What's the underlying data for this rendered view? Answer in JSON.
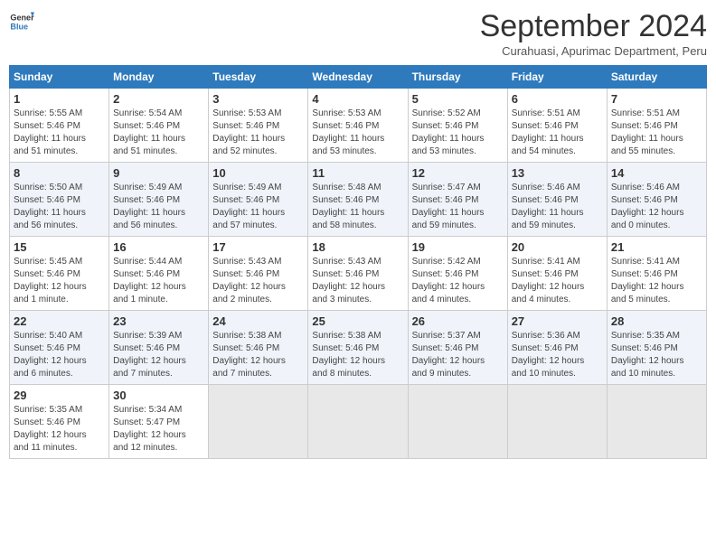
{
  "header": {
    "logo_line1": "General",
    "logo_line2": "Blue",
    "month_title": "September 2024",
    "subtitle": "Curahuasi, Apurimac Department, Peru"
  },
  "weekdays": [
    "Sunday",
    "Monday",
    "Tuesday",
    "Wednesday",
    "Thursday",
    "Friday",
    "Saturday"
  ],
  "weeks": [
    [
      {
        "day": "1",
        "info": "Sunrise: 5:55 AM\nSunset: 5:46 PM\nDaylight: 11 hours\nand 51 minutes."
      },
      {
        "day": "2",
        "info": "Sunrise: 5:54 AM\nSunset: 5:46 PM\nDaylight: 11 hours\nand 51 minutes."
      },
      {
        "day": "3",
        "info": "Sunrise: 5:53 AM\nSunset: 5:46 PM\nDaylight: 11 hours\nand 52 minutes."
      },
      {
        "day": "4",
        "info": "Sunrise: 5:53 AM\nSunset: 5:46 PM\nDaylight: 11 hours\nand 53 minutes."
      },
      {
        "day": "5",
        "info": "Sunrise: 5:52 AM\nSunset: 5:46 PM\nDaylight: 11 hours\nand 53 minutes."
      },
      {
        "day": "6",
        "info": "Sunrise: 5:51 AM\nSunset: 5:46 PM\nDaylight: 11 hours\nand 54 minutes."
      },
      {
        "day": "7",
        "info": "Sunrise: 5:51 AM\nSunset: 5:46 PM\nDaylight: 11 hours\nand 55 minutes."
      }
    ],
    [
      {
        "day": "8",
        "info": "Sunrise: 5:50 AM\nSunset: 5:46 PM\nDaylight: 11 hours\nand 56 minutes."
      },
      {
        "day": "9",
        "info": "Sunrise: 5:49 AM\nSunset: 5:46 PM\nDaylight: 11 hours\nand 56 minutes."
      },
      {
        "day": "10",
        "info": "Sunrise: 5:49 AM\nSunset: 5:46 PM\nDaylight: 11 hours\nand 57 minutes."
      },
      {
        "day": "11",
        "info": "Sunrise: 5:48 AM\nSunset: 5:46 PM\nDaylight: 11 hours\nand 58 minutes."
      },
      {
        "day": "12",
        "info": "Sunrise: 5:47 AM\nSunset: 5:46 PM\nDaylight: 11 hours\nand 59 minutes."
      },
      {
        "day": "13",
        "info": "Sunrise: 5:46 AM\nSunset: 5:46 PM\nDaylight: 11 hours\nand 59 minutes."
      },
      {
        "day": "14",
        "info": "Sunrise: 5:46 AM\nSunset: 5:46 PM\nDaylight: 12 hours\nand 0 minutes."
      }
    ],
    [
      {
        "day": "15",
        "info": "Sunrise: 5:45 AM\nSunset: 5:46 PM\nDaylight: 12 hours\nand 1 minute."
      },
      {
        "day": "16",
        "info": "Sunrise: 5:44 AM\nSunset: 5:46 PM\nDaylight: 12 hours\nand 1 minute."
      },
      {
        "day": "17",
        "info": "Sunrise: 5:43 AM\nSunset: 5:46 PM\nDaylight: 12 hours\nand 2 minutes."
      },
      {
        "day": "18",
        "info": "Sunrise: 5:43 AM\nSunset: 5:46 PM\nDaylight: 12 hours\nand 3 minutes."
      },
      {
        "day": "19",
        "info": "Sunrise: 5:42 AM\nSunset: 5:46 PM\nDaylight: 12 hours\nand 4 minutes."
      },
      {
        "day": "20",
        "info": "Sunrise: 5:41 AM\nSunset: 5:46 PM\nDaylight: 12 hours\nand 4 minutes."
      },
      {
        "day": "21",
        "info": "Sunrise: 5:41 AM\nSunset: 5:46 PM\nDaylight: 12 hours\nand 5 minutes."
      }
    ],
    [
      {
        "day": "22",
        "info": "Sunrise: 5:40 AM\nSunset: 5:46 PM\nDaylight: 12 hours\nand 6 minutes."
      },
      {
        "day": "23",
        "info": "Sunrise: 5:39 AM\nSunset: 5:46 PM\nDaylight: 12 hours\nand 7 minutes."
      },
      {
        "day": "24",
        "info": "Sunrise: 5:38 AM\nSunset: 5:46 PM\nDaylight: 12 hours\nand 7 minutes."
      },
      {
        "day": "25",
        "info": "Sunrise: 5:38 AM\nSunset: 5:46 PM\nDaylight: 12 hours\nand 8 minutes."
      },
      {
        "day": "26",
        "info": "Sunrise: 5:37 AM\nSunset: 5:46 PM\nDaylight: 12 hours\nand 9 minutes."
      },
      {
        "day": "27",
        "info": "Sunrise: 5:36 AM\nSunset: 5:46 PM\nDaylight: 12 hours\nand 10 minutes."
      },
      {
        "day": "28",
        "info": "Sunrise: 5:35 AM\nSunset: 5:46 PM\nDaylight: 12 hours\nand 10 minutes."
      }
    ],
    [
      {
        "day": "29",
        "info": "Sunrise: 5:35 AM\nSunset: 5:46 PM\nDaylight: 12 hours\nand 11 minutes."
      },
      {
        "day": "30",
        "info": "Sunrise: 5:34 AM\nSunset: 5:47 PM\nDaylight: 12 hours\nand 12 minutes."
      },
      {
        "day": "",
        "info": ""
      },
      {
        "day": "",
        "info": ""
      },
      {
        "day": "",
        "info": ""
      },
      {
        "day": "",
        "info": ""
      },
      {
        "day": "",
        "info": ""
      }
    ]
  ]
}
